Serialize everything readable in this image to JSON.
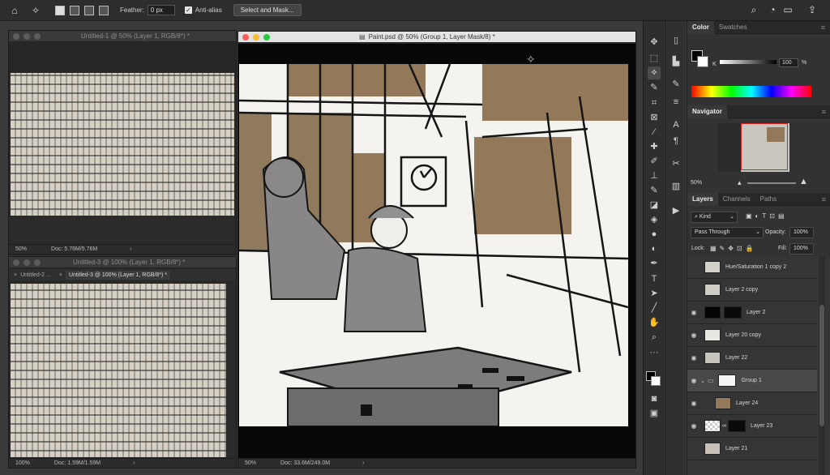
{
  "options_bar": {
    "feather_label": "Feather:",
    "feather_value": "0 px",
    "antialias_label": "Anti-alias",
    "select_mask_label": "Select and Mask..."
  },
  "windows": {
    "untitled1": {
      "title": "Untitled-1 @ 50% (Layer 1, RGB/8*) *",
      "zoom": "50%",
      "doc": "Doc: 5.76M/5.76M"
    },
    "untitled3": {
      "title": "Untitled-3 @ 100% (Layer 1, RGB/8*) *",
      "tab1": "Untitled-2 ...",
      "tab2": "Untitled-3 @ 100% (Layer 1, RGB/8*) *",
      "zoom": "100%",
      "doc": "Doc: 1.59M/1.59M"
    },
    "paint": {
      "title": "Paint.psd @ 50% (Group 1, Layer Mask/8) *",
      "zoom": "50%",
      "doc": "Doc: 33.6M/249.0M"
    }
  },
  "color_panel": {
    "tab_color": "Color",
    "tab_swatches": "Swatches",
    "channel": "K",
    "value": "100",
    "unit": "%"
  },
  "navigator": {
    "title": "Navigator",
    "zoom": "50%"
  },
  "layers_panel": {
    "tabs": [
      "Layers",
      "Channels",
      "Paths"
    ],
    "kind": "Kind",
    "blend_mode": "Pass Through",
    "opacity_label": "Opacity:",
    "opacity_value": "100%",
    "lock_label": "Lock:",
    "fill_label": "Fill:",
    "fill_value": "100%",
    "layers": [
      {
        "name": "Hue/Saturation 1 copy 2",
        "visible": false
      },
      {
        "name": "Layer 2 copy",
        "visible": false
      },
      {
        "name": "Layer 2",
        "visible": true
      },
      {
        "name": "Layer 20 copy",
        "visible": true
      },
      {
        "name": "Layer 22",
        "visible": true
      },
      {
        "name": "Group 1",
        "visible": true
      },
      {
        "name": "Layer 24",
        "visible": true
      },
      {
        "name": "Layer 23",
        "visible": true
      },
      {
        "name": "Layer 21",
        "visible": false
      }
    ]
  },
  "colors": {
    "accent_brown": "#93795a",
    "canvas_bg": "#070707"
  }
}
